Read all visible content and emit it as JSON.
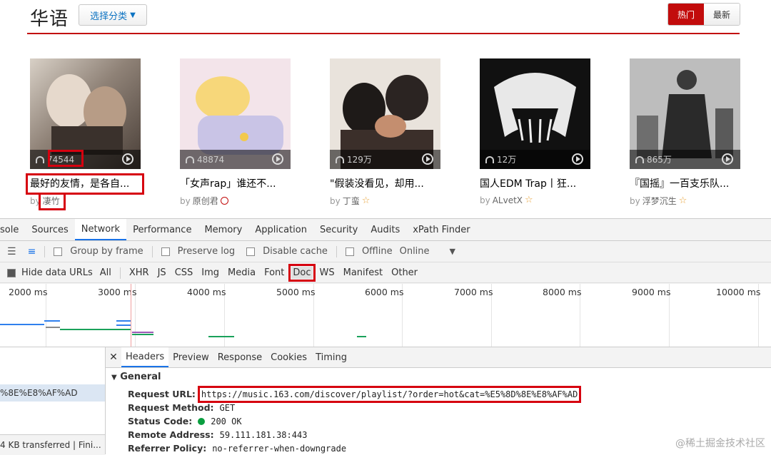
{
  "page": {
    "title": "华语",
    "category_button": "选择分类",
    "sort": {
      "hot": "热门",
      "new": "最新"
    },
    "cards": [
      {
        "plays": "74544",
        "title": "最好的友情，是各自...",
        "by": "by",
        "author": "凄竹",
        "badge": "none"
      },
      {
        "plays": "48874",
        "title": "「女声rap」谁还不...",
        "by": "by",
        "author": "原创君",
        "badge": "v"
      },
      {
        "plays": "129万",
        "title": "\"假装没看见，却用...",
        "by": "by",
        "author": "丁蛮",
        "badge": "star"
      },
      {
        "plays": "12万",
        "title": "国人EDM Trap丨狂...",
        "by": "by",
        "author": "ALvetX",
        "badge": "star"
      },
      {
        "plays": "865万",
        "title": "『国摇』一百支乐队...",
        "by": "by",
        "author": "浮梦沉生",
        "badge": "star"
      }
    ]
  },
  "devtools": {
    "tabs": [
      "sole",
      "Sources",
      "Network",
      "Performance",
      "Memory",
      "Application",
      "Security",
      "Audits",
      "xPath Finder"
    ],
    "toolbar": {
      "group_by_frame": "Group by frame",
      "preserve_log": "Preserve log",
      "disable_cache": "Disable cache",
      "offline": "Offline",
      "throttle": "Online"
    },
    "filter": {
      "hide_data_urls": "Hide data URLs",
      "types": [
        "All",
        "XHR",
        "JS",
        "CSS",
        "Img",
        "Media",
        "Font",
        "Doc",
        "WS",
        "Manifest",
        "Other"
      ],
      "highlighted": "Doc"
    },
    "timeline_ticks": [
      "2000 ms",
      "3000 ms",
      "4000 ms",
      "5000 ms",
      "6000 ms",
      "7000 ms",
      "8000 ms",
      "9000 ms",
      "10000 ms"
    ],
    "request_list": {
      "selected_name": "%8E%E8%AF%AD",
      "footer": "4 KB transferred | Fini..."
    },
    "detail_tabs": [
      "Headers",
      "Preview",
      "Response",
      "Cookies",
      "Timing"
    ],
    "general": {
      "heading": "General",
      "request_url_label": "Request URL:",
      "request_url": "https://music.163.com/discover/playlist/?order=hot&cat=%E5%8D%8E%E8%AF%AD",
      "request_method_label": "Request Method:",
      "request_method": "GET",
      "status_code_label": "Status Code:",
      "status_code": "200 OK",
      "remote_address_label": "Remote Address:",
      "remote_address": "59.111.181.38:443",
      "referrer_policy_label": "Referrer Policy:",
      "referrer_policy": "no-referrer-when-downgrade"
    }
  },
  "watermark": "@稀土掘金技术社区"
}
